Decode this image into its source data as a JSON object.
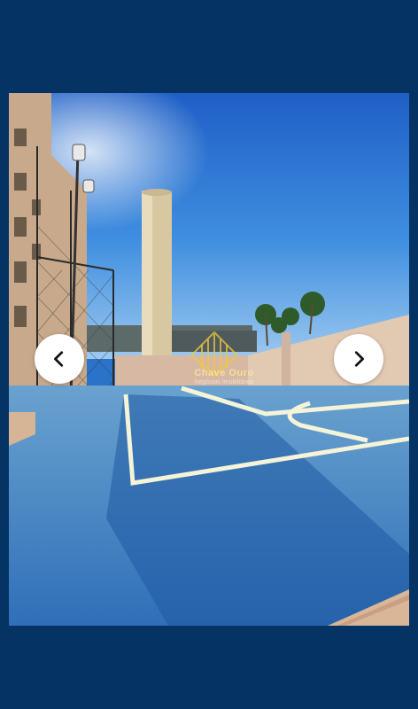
{
  "viewer": {
    "background_color": "#053363",
    "prev_button": {
      "icon": "chevron-left-icon"
    },
    "next_button": {
      "icon": "chevron-right-icon"
    }
  },
  "photo": {
    "watermark": {
      "name": "Chave Ouro",
      "tagline": "Negócios Imobiliários"
    }
  }
}
